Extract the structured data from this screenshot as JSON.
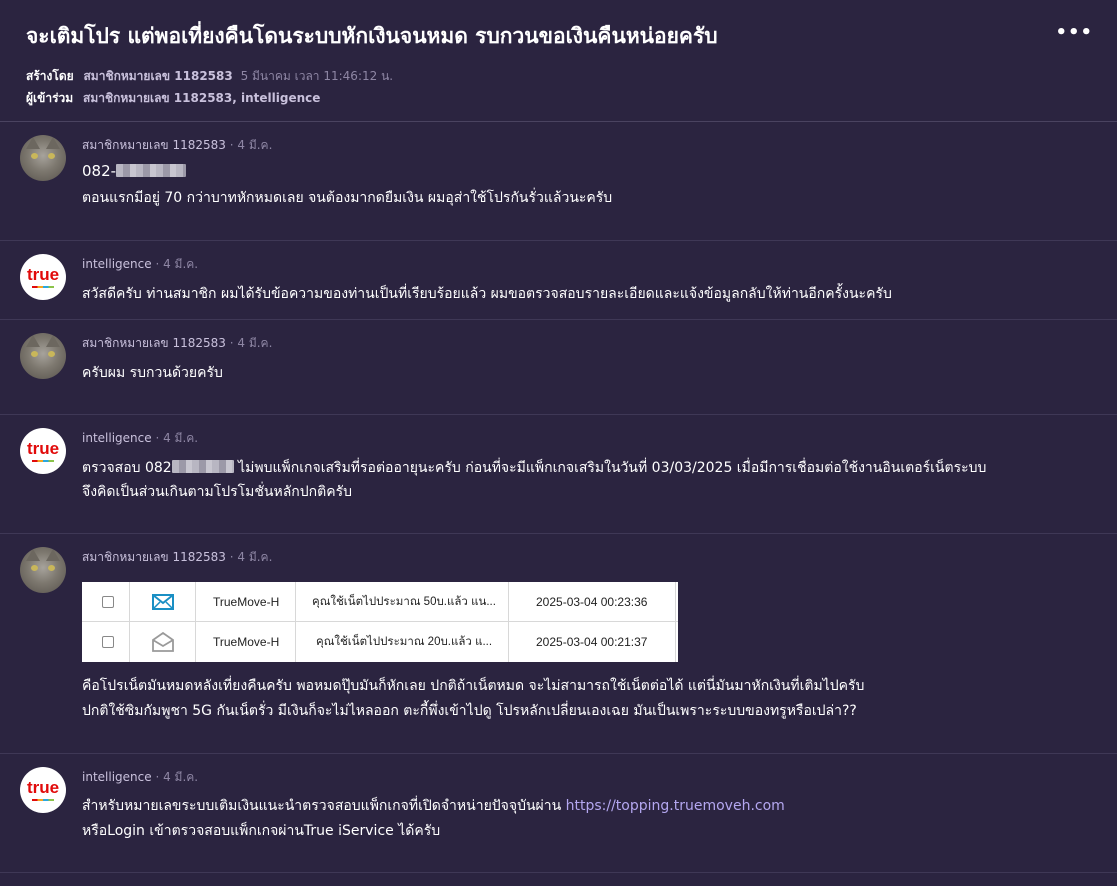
{
  "topic": {
    "title": "จะเติมโปร แต่พอเที่ยงคืนโดนระบบหักเงินจนหมด รบกวนขอเงินคืนหน่อยครับ",
    "more": "•••",
    "created_label": "สร้างโดย",
    "created_user": "สมาชิกหมายเลข 1182583",
    "created_time": "5 มีนาคม เวลา 11:46:12 น.",
    "participants_label": "ผู้เข้าร่วม",
    "participants": "สมาชิกหมายเลข 1182583, intelligence"
  },
  "posts": [
    {
      "user": "สมาชิกหมายเลข 1182583",
      "sep": "·",
      "date": "4 มี.ค.",
      "avatar": "cat-avatar-icon",
      "phone_prefix": "082-",
      "text": "ตอนแรกมีอยู่ 70 กว่าบาทหักหมดเลย จนต้องมากดยืมเงิน  ผมอุส่าใช้โปรกันรั่วแล้วนะครับ"
    },
    {
      "user": "intelligence",
      "sep": "·",
      "date": "4 มี.ค.",
      "avatar": "true-logo-icon",
      "logo_text": "true",
      "text": "สวัสดีครับ ท่านสมาชิก ผมได้รับข้อความของท่านเป็นที่เรียบร้อยแล้ว ผมขอตรวจสอบรายละเอียดและแจ้งข้อมูลกลับให้ท่านอีกครั้งนะครับ"
    },
    {
      "user": "สมาชิกหมายเลข 1182583",
      "sep": "·",
      "date": "4 มี.ค.",
      "avatar": "cat-avatar-icon",
      "text": "ครับผม รบกวนด้วยครับ"
    },
    {
      "user": "intelligence",
      "sep": "·",
      "date": "4 มี.ค.",
      "avatar": "true-logo-icon",
      "logo_text": "true",
      "text_prefix": "ตรวจสอบ 082",
      "text_line1": " ไม่พบแพ็กเกจเสริมที่รอต่ออายุนะครับ ก่อนที่จะมีแพ็กเกจเสริมในวันที่ 03/03/2025  เมื่อมีการเชื่อมต่อใช้งานอินเตอร์เน็ตระบบ",
      "text_line2": "จึงคิดเป็นส่วนเกินตามโปรโมชั่นหลักปกติครับ"
    },
    {
      "user": "สมาชิกหมายเลข 1182583",
      "sep": "·",
      "date": "4 มี.ค.",
      "avatar": "cat-avatar-icon",
      "attachment": {
        "rows": [
          {
            "icon": "envelope-closed-icon",
            "sender": "TrueMove-H",
            "preview": "คุณใช้เน็ตไปประมาณ 50บ.แล้ว แน...",
            "time": "2025-03-04 00:23:36"
          },
          {
            "icon": "envelope-open-icon",
            "sender": "TrueMove-H",
            "preview": "คุณใช้เน็ตไปประมาณ 20บ.แล้ว แ...",
            "time": "2025-03-04 00:21:37"
          }
        ]
      },
      "text_line1": "คือโปรเน็ตมันหมดหลังเที่ยงคืนครับ พอหมดปุ๊บมันก็หักเลย ปกติถ้าเน็ตหมด จะไม่สามารถใช้เน็ตต่อได้ แต่นี่มันมาหักเงินที่เติมไปครับ",
      "text_line2": "ปกติใช้ซิมกัมพูชา 5G กันเน็ตรั่ว มีเงินก็จะไม่ไหลออก ตะกี้พึ่งเข้าไปดู โปรหลักเปลี่ยนเองเฉย มันเป็นเพราะระบบของทรูหรือเปล่า??"
    },
    {
      "user": "intelligence",
      "sep": "·",
      "date": "4 มี.ค.",
      "avatar": "true-logo-icon",
      "logo_text": "true",
      "text_line1": "สำหรับหมายเลขระบบเติมเงินแนะนำตรวจสอบแพ็กเกจที่เปิดจำหน่ายปัจจุบันผ่าน ",
      "link": "https://topping.truemoveh.com",
      "text_line2": "หรือLogin เข้าตรวจสอบแพ็กเกจผ่านTrue iService ได้ครับ"
    }
  ]
}
